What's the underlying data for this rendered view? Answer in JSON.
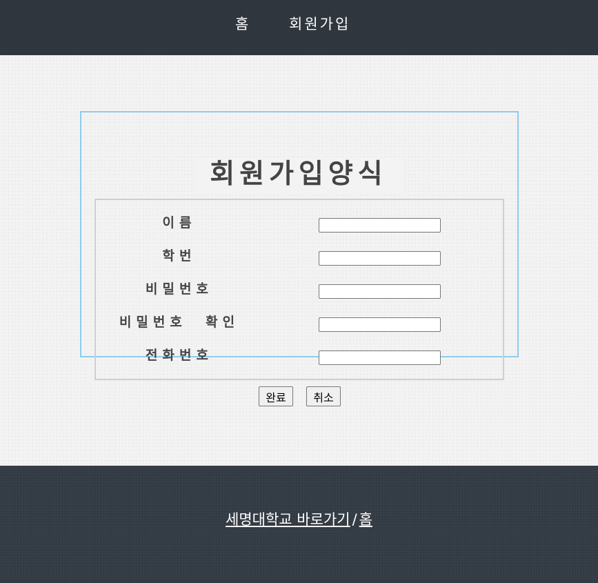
{
  "nav": {
    "items": [
      {
        "label": "홈"
      },
      {
        "label": "회원가입"
      }
    ]
  },
  "form": {
    "title": "회원가입양식",
    "fields": [
      {
        "label": "이름",
        "value": ""
      },
      {
        "label": "학번",
        "value": ""
      },
      {
        "label": "비밀번호",
        "value": ""
      },
      {
        "label": "비밀번호  확인",
        "value": ""
      },
      {
        "label": "전화번호",
        "value": ""
      }
    ],
    "buttons": {
      "submit_label": "완료",
      "cancel_label": "취소"
    }
  },
  "footer": {
    "link1": "세명대학교 바로가기",
    "separator": "/",
    "link2": "홈"
  },
  "colors": {
    "header_bg": "#2e353d",
    "footer_bg": "#363e47",
    "fieldset_border": "#8fcbeb",
    "inner_border": "#cfcfcf",
    "title_text": "#444444"
  }
}
